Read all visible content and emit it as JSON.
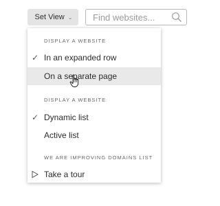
{
  "toolbar": {
    "set_view_label": "Set View",
    "search_placeholder": "Find websites..."
  },
  "menu": {
    "section1_title": "DISPLAY A WEBSITE",
    "section1_items": [
      {
        "label": "In an expanded row",
        "checked": true
      },
      {
        "label": "On a separate page",
        "checked": false,
        "hovered": true
      }
    ],
    "section2_title": "DISPLAY A WEBSITE",
    "section2_items": [
      {
        "label": "Dynamic list",
        "checked": true
      },
      {
        "label": "Active list",
        "checked": false
      }
    ],
    "section3_title": "WE ARE IMPROVING DOMAINS LIST",
    "section3_items": [
      {
        "label": "Take a tour",
        "icon": "play-outline-icon"
      }
    ]
  },
  "colors": {
    "button_bg": "#e4e4e4",
    "hover_bg": "#e9e9e9"
  }
}
